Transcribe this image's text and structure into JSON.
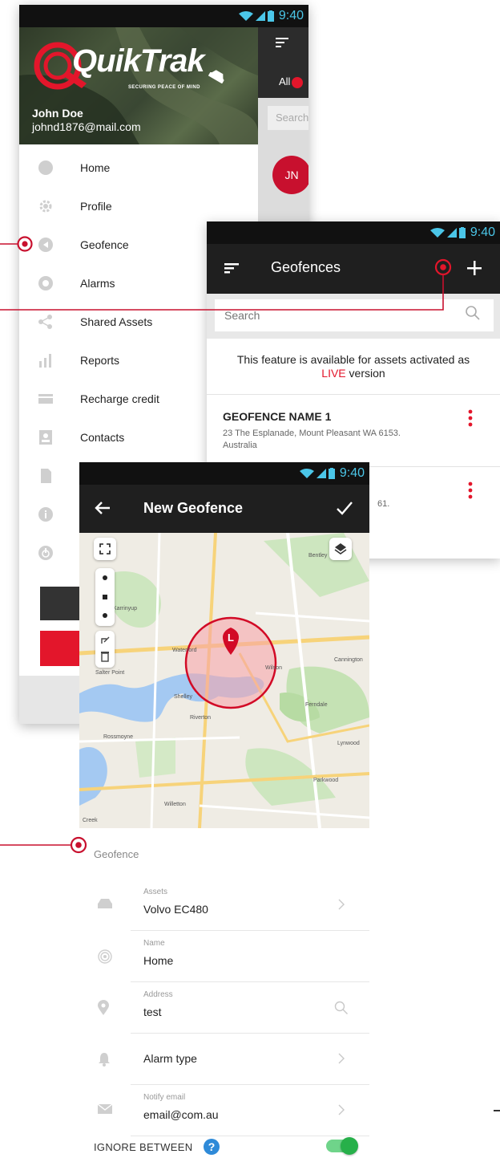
{
  "status_bar": {
    "time": "9:40"
  },
  "drawer": {
    "logo_text": "QuikTrak",
    "logo_tagline": "SECURING PEACE OF MIND",
    "user_name": "John Doe",
    "user_email": "johnd1876@mail.com",
    "items": [
      {
        "label": "Home",
        "icon": "home-icon"
      },
      {
        "label": "Profile",
        "icon": "gear-icon"
      },
      {
        "label": "Geofence",
        "icon": "geofence-icon"
      },
      {
        "label": "Alarms",
        "icon": "alarm-icon"
      },
      {
        "label": "Shared Assets",
        "icon": "share-icon"
      },
      {
        "label": "Reports",
        "icon": "bar-chart-icon"
      },
      {
        "label": "Recharge credit",
        "icon": "credit-card-icon"
      },
      {
        "label": "Contacts",
        "icon": "contacts-icon"
      }
    ],
    "extra_icons": [
      "document-icon",
      "info-icon",
      "power-icon"
    ]
  },
  "background_app": {
    "tab_label": "All",
    "search_placeholder": "Search",
    "avatar_initials": "JN"
  },
  "geofences": {
    "title": "Geofences",
    "search_placeholder": "Search",
    "notice_before": "This feature is available for assets activated as ",
    "notice_live": "LIVE",
    "notice_after": " version",
    "items": [
      {
        "name": "GEOFENCE NAME 1",
        "address": "23 The Esplanade, Mount Pleasant WA 6153. Australia"
      },
      {
        "name": "",
        "address": "61."
      }
    ]
  },
  "new_geofence": {
    "title": "New Geofence",
    "map": {
      "pin_label": "L",
      "places": [
        "Bentley",
        "Karrinyup",
        "Waterford",
        "Wilson",
        "Cannington",
        "Salter Point",
        "Shelley",
        "Riverton",
        "Ferndale",
        "Rossmoyne",
        "Lynwood",
        "Parkwood",
        "Willetton",
        "Creek"
      ]
    },
    "section_label": "Geofence",
    "fields": {
      "assets": {
        "caption": "Assets",
        "value": "Volvo EC480"
      },
      "name": {
        "caption": "Name",
        "value": "Home"
      },
      "address": {
        "caption": "Address",
        "value": "test"
      },
      "alarm_type": {
        "value": "Alarm type"
      },
      "notify_email": {
        "caption": "Notify email",
        "value": "email@com.au"
      }
    },
    "ignore_between_label": "IGNORE BETWEEN",
    "ignore_between_enabled": true
  },
  "colors": {
    "accent_red": "#e3162b",
    "toolbar_dark": "#1f1f1f",
    "toggle_green": "#27b04a",
    "status_blue": "#4bc6e8"
  }
}
